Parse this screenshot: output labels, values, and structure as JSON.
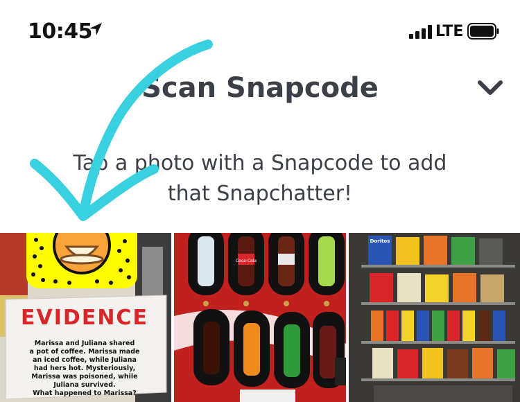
{
  "status": {
    "time": "10:45",
    "network": "LTE",
    "location_icon": "location-arrow-icon",
    "signal_icon": "signal-bars-icon",
    "battery_icon": "battery-full-icon"
  },
  "header": {
    "title": "Scan Snapcode",
    "close_icon": "chevron-down-icon"
  },
  "instructions": {
    "line1": "Tap a photo with a Snapcode to add",
    "line2": "that Snapchatter!"
  },
  "photos": [
    {
      "sign_heading": "EVIDENCE",
      "sign_lines": [
        "Marissa and Juliana shared",
        "a pot of coffee. Marissa made",
        "an iced coffee, while Juliana",
        "had hers hot. Mysteriously,",
        "Marissa was poisoned, while",
        "Juliana survived.",
        "What happened to Marissa?"
      ]
    },
    {
      "bottle_label": "Coca-Cola"
    },
    {
      "chip_label": "Doritos"
    }
  ],
  "colors": {
    "title": "#3b3f47",
    "annotation_arrow": "#39d0e0",
    "snapcode_yellow": "#fffc00",
    "evidence_red": "#d8262b"
  }
}
